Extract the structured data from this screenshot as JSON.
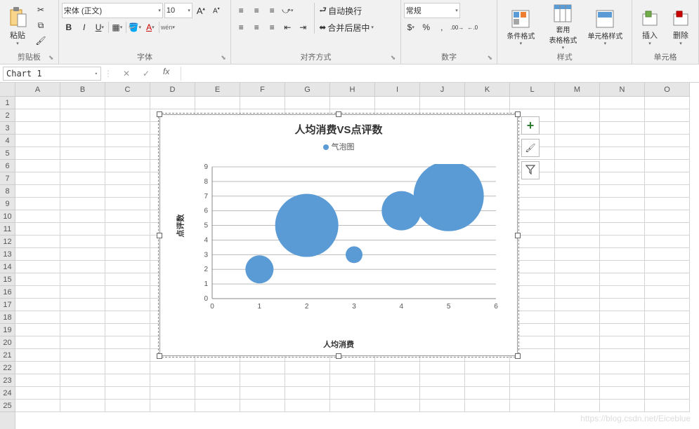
{
  "ribbon": {
    "clipboard": {
      "paste": "粘贴",
      "label": "剪贴板"
    },
    "font": {
      "name": "宋体 (正文)",
      "size": "10",
      "bold": "B",
      "italic": "I",
      "underline": "U",
      "wen": "wén",
      "label": "字体"
    },
    "align": {
      "wrap": "自动换行",
      "merge": "合并后居中",
      "label": "对齐方式"
    },
    "number": {
      "format": "常规",
      "label": "数字"
    },
    "styles": {
      "cond": "条件格式",
      "table": "套用\n表格格式",
      "cell": "单元格样式",
      "label": "样式"
    },
    "cells": {
      "insert": "插入",
      "delete": "删除",
      "label": "单元格"
    }
  },
  "namebox": {
    "value": "Chart 1",
    "fx": "fx"
  },
  "grid": {
    "cols": [
      "A",
      "B",
      "C",
      "D",
      "E",
      "F",
      "G",
      "H",
      "I",
      "J",
      "K",
      "L",
      "M",
      "N",
      "O"
    ],
    "rows": 25
  },
  "chart_data": {
    "type": "bubble",
    "title": "人均消费VS点评数",
    "legend": "气泡图",
    "xlabel": "人均消费",
    "ylabel": "点评数",
    "xlim": [
      0,
      6
    ],
    "ylim": [
      0,
      9
    ],
    "xticks": [
      0,
      1,
      2,
      3,
      4,
      5,
      6
    ],
    "yticks": [
      0,
      1,
      2,
      3,
      4,
      5,
      6,
      7,
      8,
      9
    ],
    "series": [
      {
        "name": "气泡图",
        "points": [
          {
            "x": 1,
            "y": 2,
            "size": 20
          },
          {
            "x": 2,
            "y": 5,
            "size": 45
          },
          {
            "x": 3,
            "y": 3,
            "size": 12
          },
          {
            "x": 4,
            "y": 6,
            "size": 28
          },
          {
            "x": 5,
            "y": 7,
            "size": 50
          }
        ]
      }
    ]
  },
  "side_buttons": {
    "add": "+",
    "brush": "✎",
    "filter": "▼"
  },
  "watermark": "https://blog.csdn.net/Eiceblue"
}
